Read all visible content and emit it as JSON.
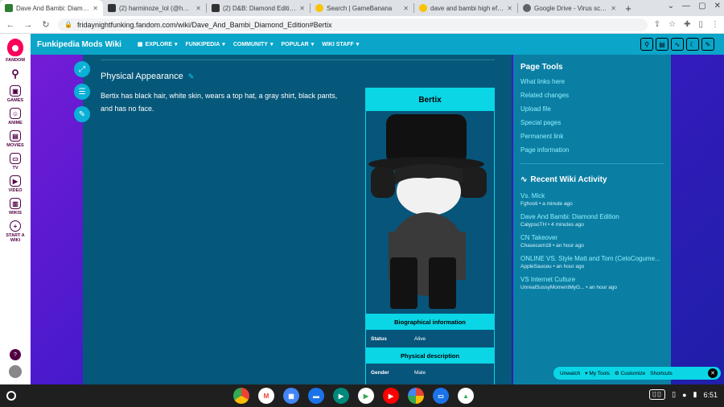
{
  "tabs": [
    {
      "title": "Dave And Bambi: Diamond",
      "active": true,
      "color": "#2e7d32"
    },
    {
      "title": "(2) harminoze_lol (@harmin",
      "active": false,
      "color": "#333333"
    },
    {
      "title": "(2) D&B: Diamond Edition C",
      "active": false,
      "color": "#333333"
    },
    {
      "title": "Search | GameBanana",
      "active": false,
      "color": "#f9c300"
    },
    {
      "title": "dave and bambi high effort",
      "active": false,
      "color": "#f9c300"
    },
    {
      "title": "Google Drive - Virus scan w",
      "active": false,
      "color": "#5f6368"
    }
  ],
  "browser": {
    "url": "fridaynightfunking.fandom.com/wiki/Dave_And_Bambi_Diamond_Edition#Bertix",
    "new_tab": "+"
  },
  "rail": [
    {
      "label": "FANDOM",
      "icon": "fandom-logo-icon"
    },
    {
      "label": "",
      "icon": "search-icon",
      "glyph": "⚲"
    },
    {
      "label": "GAMES",
      "icon": "games-icon",
      "glyph": "▣"
    },
    {
      "label": "ANIME",
      "icon": "anime-icon",
      "glyph": "☺"
    },
    {
      "label": "MOVIES",
      "icon": "movies-icon",
      "glyph": "▤"
    },
    {
      "label": "TV",
      "icon": "tv-icon",
      "glyph": "▭"
    },
    {
      "label": "VIDEO",
      "icon": "video-icon",
      "glyph": "▶"
    },
    {
      "label": "WIKIS",
      "icon": "wikis-icon",
      "glyph": "▥"
    },
    {
      "label": "START A WIKI",
      "icon": "start-wiki-icon",
      "glyph": "+"
    }
  ],
  "wiki": {
    "name": "Funkipedia Mods Wiki",
    "nav": [
      "EXPLORE",
      "FUNKIPEDIA",
      "COMMUNITY",
      "POPULAR",
      "WIKI STAFF"
    ]
  },
  "article": {
    "heading": "Physical Appearance",
    "paragraph": "Bertix has black hair, white skin, wears a top hat, a gray shirt, black pants, and has no face."
  },
  "infobox": {
    "title": "Bertix",
    "bio_header": "Biographical information",
    "status_key": "Status",
    "status_val": "Alive",
    "phys_header": "Physical description",
    "gender_key": "Gender",
    "gender_val": "Male"
  },
  "page_tools": {
    "title": "Page Tools",
    "links": [
      "What links here",
      "Related changes",
      "Upload file",
      "Special pages",
      "Permanent link",
      "Page information"
    ]
  },
  "activity": {
    "title": "Recent Wiki Activity",
    "items": [
      {
        "title": "Vs. Mick",
        "meta": "Fghosti • a minute ago"
      },
      {
        "title": "Dave And Bambi: Diamond Edition",
        "meta": "CalypsoTH • 4 minutes ago"
      },
      {
        "title": "CN Takeover",
        "meta": "Chasecam18 • an hour ago"
      },
      {
        "title": "ONLINE VS. Style Matt and Tom (CeloCogume...",
        "meta": "AppleSauceu • an hour ago"
      },
      {
        "title": "VS Internet Culture",
        "meta": "UnrealSussyMomentMyG... • an hour ago"
      }
    ]
  },
  "bottom_toolbar": {
    "unwatch": "Unwatch",
    "mytools": "My Tools",
    "customize": "Customize",
    "shortcuts": "Shortcuts"
  },
  "shelf": {
    "time": "6:51"
  },
  "colors": {
    "accent": "#0ad6e6",
    "wikibar": "#0aa5c8",
    "article_bg": "#06587a",
    "panel_bg": "#0b7fa3"
  }
}
